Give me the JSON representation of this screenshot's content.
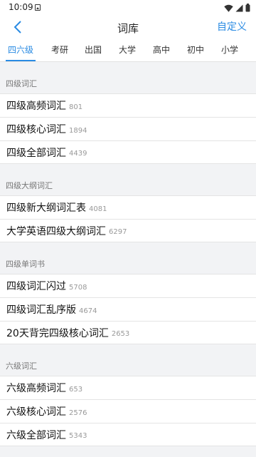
{
  "status_bar": {
    "time": "10:09"
  },
  "nav": {
    "title": "词库",
    "custom_label": "自定义"
  },
  "tabs": [
    {
      "label": "四六级",
      "active": true
    },
    {
      "label": "考研"
    },
    {
      "label": "出国"
    },
    {
      "label": "大学"
    },
    {
      "label": "高中"
    },
    {
      "label": "初中"
    },
    {
      "label": "小学"
    }
  ],
  "sections": [
    {
      "title": "四级词汇",
      "items": [
        {
          "name": "四级高频词汇",
          "count": "801"
        },
        {
          "name": "四级核心词汇",
          "count": "1894"
        },
        {
          "name": "四级全部词汇",
          "count": "4439"
        }
      ]
    },
    {
      "title": "四级大纲词汇",
      "items": [
        {
          "name": "四级新大纲词汇表",
          "count": "4081"
        },
        {
          "name": "大学英语四级大纲词汇",
          "count": "6297"
        }
      ]
    },
    {
      "title": "四级单词书",
      "items": [
        {
          "name": "四级词汇闪过",
          "count": "5708"
        },
        {
          "name": "四级词汇乱序版",
          "count": "4674"
        },
        {
          "name": "20天背完四级核心词汇",
          "count": "2653"
        }
      ]
    },
    {
      "title": "六级词汇",
      "items": [
        {
          "name": "六级高频词汇",
          "count": "653"
        },
        {
          "name": "六级核心词汇",
          "count": "2576"
        },
        {
          "name": "六级全部词汇",
          "count": "5343"
        }
      ]
    }
  ],
  "colors": {
    "accent": "#2a8be3",
    "background": "#f2f3f5"
  }
}
